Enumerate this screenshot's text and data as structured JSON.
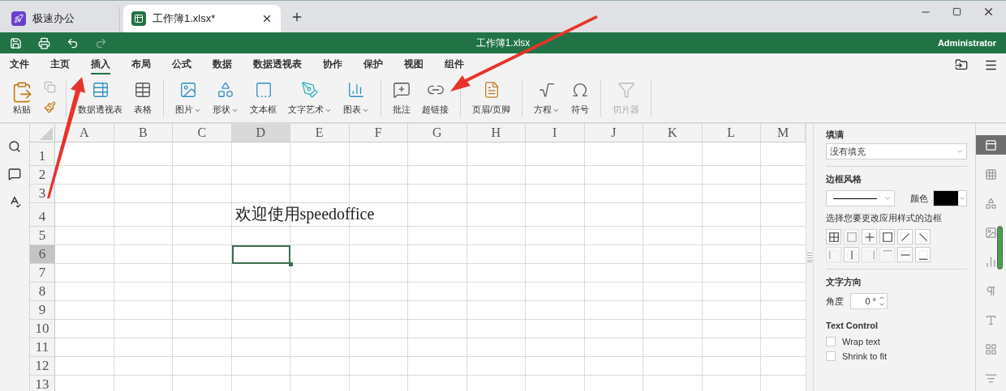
{
  "window_tabs": [
    {
      "title": "极速办公",
      "selected": false,
      "kind": "app"
    },
    {
      "title": "工作簿1.xlsx*",
      "selected": true,
      "kind": "document"
    }
  ],
  "title_bar": {
    "document": "工作簿1.xlsx",
    "user": "Administrator",
    "quick_actions": [
      {
        "disabled": false
      },
      {
        "disabled": false
      },
      {
        "disabled": false
      },
      {
        "disabled": true
      }
    ]
  },
  "menu": [
    {
      "label": "文件",
      "selected": false
    },
    {
      "label": "主页",
      "selected": false
    },
    {
      "label": "插入",
      "selected": true
    },
    {
      "label": "布局",
      "selected": false
    },
    {
      "label": "公式",
      "selected": false
    },
    {
      "label": "数据",
      "selected": false
    },
    {
      "label": "数据透视表",
      "selected": false
    },
    {
      "label": "协作",
      "selected": false
    },
    {
      "label": "保护",
      "selected": false
    },
    {
      "label": "视图",
      "selected": false
    },
    {
      "label": "组件",
      "selected": false
    }
  ],
  "ribbon": [
    {
      "items": [
        {
          "kind": "large",
          "label": "粘贴",
          "disabled": false,
          "dropdown": false
        },
        {
          "kind": "small",
          "disabled": true
        },
        {
          "kind": "small",
          "disabled": false
        }
      ]
    },
    {
      "items": [
        {
          "kind": "large",
          "label": "数据透视表",
          "disabled": false,
          "dropdown": false
        },
        {
          "kind": "large",
          "label": "表格",
          "disabled": false,
          "dropdown": false
        }
      ]
    },
    {
      "items": [
        {
          "kind": "large",
          "label": "图片",
          "disabled": false,
          "dropdown": true
        },
        {
          "kind": "large",
          "label": "形状",
          "disabled": false,
          "dropdown": true
        },
        {
          "kind": "large",
          "label": "文本框",
          "disabled": false,
          "dropdown": false
        },
        {
          "kind": "large",
          "label": "文字艺术",
          "disabled": false,
          "dropdown": true
        },
        {
          "kind": "large",
          "label": "图表",
          "disabled": false,
          "dropdown": true
        }
      ]
    },
    {
      "items": [
        {
          "kind": "large",
          "label": "批注",
          "disabled": false,
          "dropdown": false
        },
        {
          "kind": "large",
          "label": "超链接",
          "disabled": false,
          "dropdown": false
        }
      ]
    },
    {
      "items": [
        {
          "kind": "large",
          "label": "页眉/页脚",
          "disabled": false,
          "dropdown": false
        }
      ]
    },
    {
      "items": [
        {
          "kind": "large",
          "label": "方程",
          "disabled": false,
          "dropdown": true
        },
        {
          "kind": "large",
          "label": "符号",
          "disabled": false,
          "dropdown": false
        }
      ]
    },
    {
      "items": [
        {
          "kind": "large",
          "label": "切片器",
          "disabled": true,
          "dropdown": false
        }
      ]
    }
  ],
  "sheet": {
    "columns": [
      {
        "label": "A",
        "selected": false
      },
      {
        "label": "B",
        "selected": false
      },
      {
        "label": "C",
        "selected": false
      },
      {
        "label": "D",
        "selected": true
      },
      {
        "label": "E",
        "selected": false
      },
      {
        "label": "F",
        "selected": false
      },
      {
        "label": "G",
        "selected": false
      },
      {
        "label": "H",
        "selected": false
      },
      {
        "label": "I",
        "selected": false
      },
      {
        "label": "J",
        "selected": false
      },
      {
        "label": "K",
        "selected": false
      },
      {
        "label": "L",
        "selected": false
      },
      {
        "label": "M",
        "selected": false
      }
    ],
    "rows": [
      {
        "label": "1",
        "selected": false
      },
      {
        "label": "2",
        "selected": false
      },
      {
        "label": "3",
        "selected": false
      },
      {
        "label": "4",
        "selected": false,
        "cells": [
          {},
          {},
          {},
          {
            "text": "欢迎使用speedoffice"
          }
        ]
      },
      {
        "label": "5",
        "selected": false
      },
      {
        "label": "6",
        "selected": true
      },
      {
        "label": "7",
        "selected": false
      },
      {
        "label": "8",
        "selected": false
      },
      {
        "label": "9",
        "selected": false
      },
      {
        "label": "10",
        "selected": false
      },
      {
        "label": "11",
        "selected": false
      },
      {
        "label": "12",
        "selected": false
      },
      {
        "label": "13",
        "selected": false
      }
    ]
  },
  "format_panel": {
    "fill_title": "填满",
    "fill_value": "没有填充",
    "border_title": "边框风格",
    "color_label": "颜色",
    "border_hint": "选择您要更改应用样式的边框",
    "border_buttons": [
      {
        "disabled": false
      },
      {
        "disabled": true
      },
      {
        "disabled": false
      },
      {
        "disabled": false
      },
      {
        "disabled": false
      },
      {
        "disabled": false
      },
      {
        "disabled": true
      },
      {
        "disabled": false
      },
      {
        "disabled": true
      },
      {
        "disabled": true
      },
      {
        "disabled": false
      },
      {
        "disabled": false
      }
    ],
    "direction_title": "文字方向",
    "angle_label": "角度",
    "angle_value": "0 °",
    "text_control_title": "Text Control",
    "checkboxes": [
      {
        "label": "Wrap text",
        "checked": false
      },
      {
        "label": "Shrink to fit",
        "checked": false
      }
    ]
  },
  "side_tabs": [
    {
      "selected": true
    },
    {
      "selected": false
    },
    {
      "selected": false
    },
    {
      "selected": false
    },
    {
      "selected": false
    },
    {
      "selected": false
    },
    {
      "selected": false
    },
    {
      "selected": false
    },
    {
      "selected": false
    }
  ]
}
